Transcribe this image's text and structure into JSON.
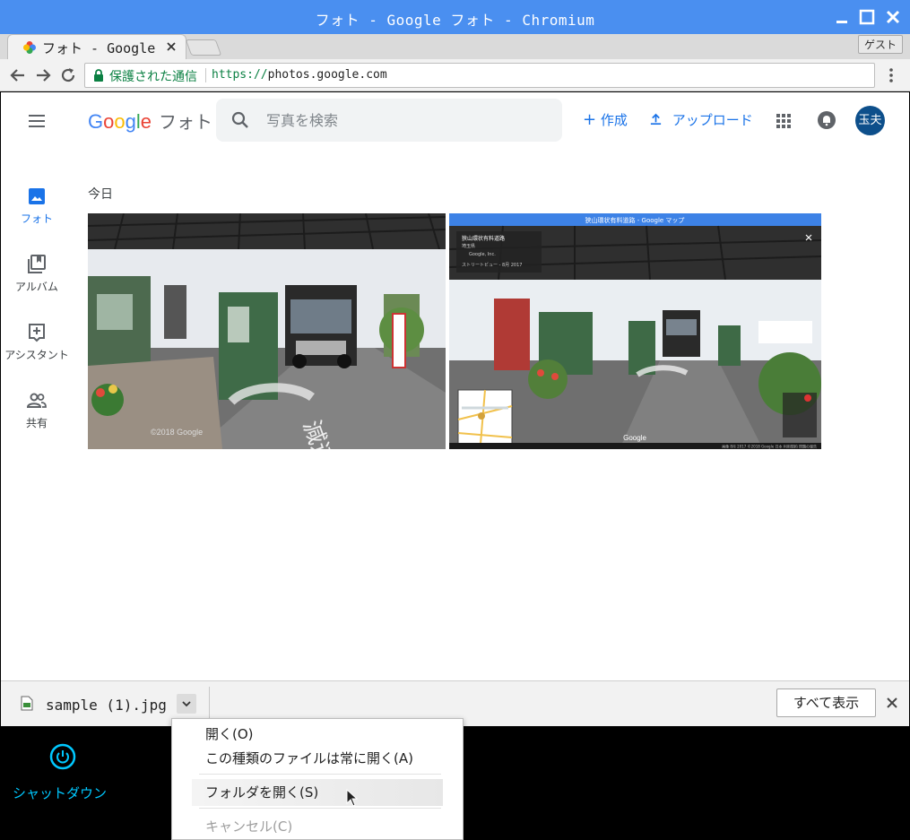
{
  "window": {
    "title": "フォト - Google フォト - Chromium"
  },
  "tabs": [
    {
      "label": "フォト - Google フォト"
    }
  ],
  "profile": {
    "label": "ゲスト"
  },
  "omnibox": {
    "security_text": "保護された通信",
    "url_scheme": "https://",
    "url_host": "photos.google.com"
  },
  "header": {
    "logo": "Google",
    "product": "フォト",
    "search_placeholder": "写真を検索",
    "create_label": "作成",
    "upload_label": "アップロード",
    "avatar_text": "玉夫"
  },
  "sidebar": {
    "items": [
      {
        "label": "フォト",
        "icon": "photo-icon",
        "active": true
      },
      {
        "label": "アルバム",
        "icon": "album-icon",
        "active": false
      },
      {
        "label": "アシスタント",
        "icon": "assistant-icon",
        "active": false
      },
      {
        "label": "共有",
        "icon": "people-icon",
        "active": false
      }
    ]
  },
  "main": {
    "section_title": "今日",
    "photos": [
      {
        "name": "toll-gate-street-view-photo",
        "watermark": "©2018 Google"
      },
      {
        "name": "toll-gate-maps-screenshot",
        "window_title": "狭山環状有料道路 - Google マップ",
        "place_name": "狭山環状有料道路",
        "place_sub": "埼玉県",
        "owner": "Google, Inc.",
        "date": "ストリートビュー - 8月 2017",
        "google_label": "Google",
        "footer": "画像 8月 2017   ©2018 Google   日本   利用規約   問題の報告"
      }
    ]
  },
  "download_shelf": {
    "file_name": "sample (1).jpg",
    "show_all_label": "すべて表示"
  },
  "context_menu": {
    "items": [
      {
        "label": "開く(O)",
        "enabled": true,
        "highlighted": false
      },
      {
        "label": "この種類のファイルは常に開く(A)",
        "enabled": true,
        "highlighted": false
      },
      {
        "label": "フォルダを開く(S)",
        "enabled": true,
        "highlighted": true
      },
      {
        "label": "キャンセル(C)",
        "enabled": false,
        "highlighted": false
      }
    ]
  },
  "desktop": {
    "shutdown_label": "シャットダウン"
  },
  "colors": {
    "titlebar": "#4a8ff0",
    "accent": "#1a73e8",
    "secure_green": "#0b8043",
    "avatar_bg": "#0d4f8b",
    "shutdown_cyan": "#00c8ff"
  }
}
